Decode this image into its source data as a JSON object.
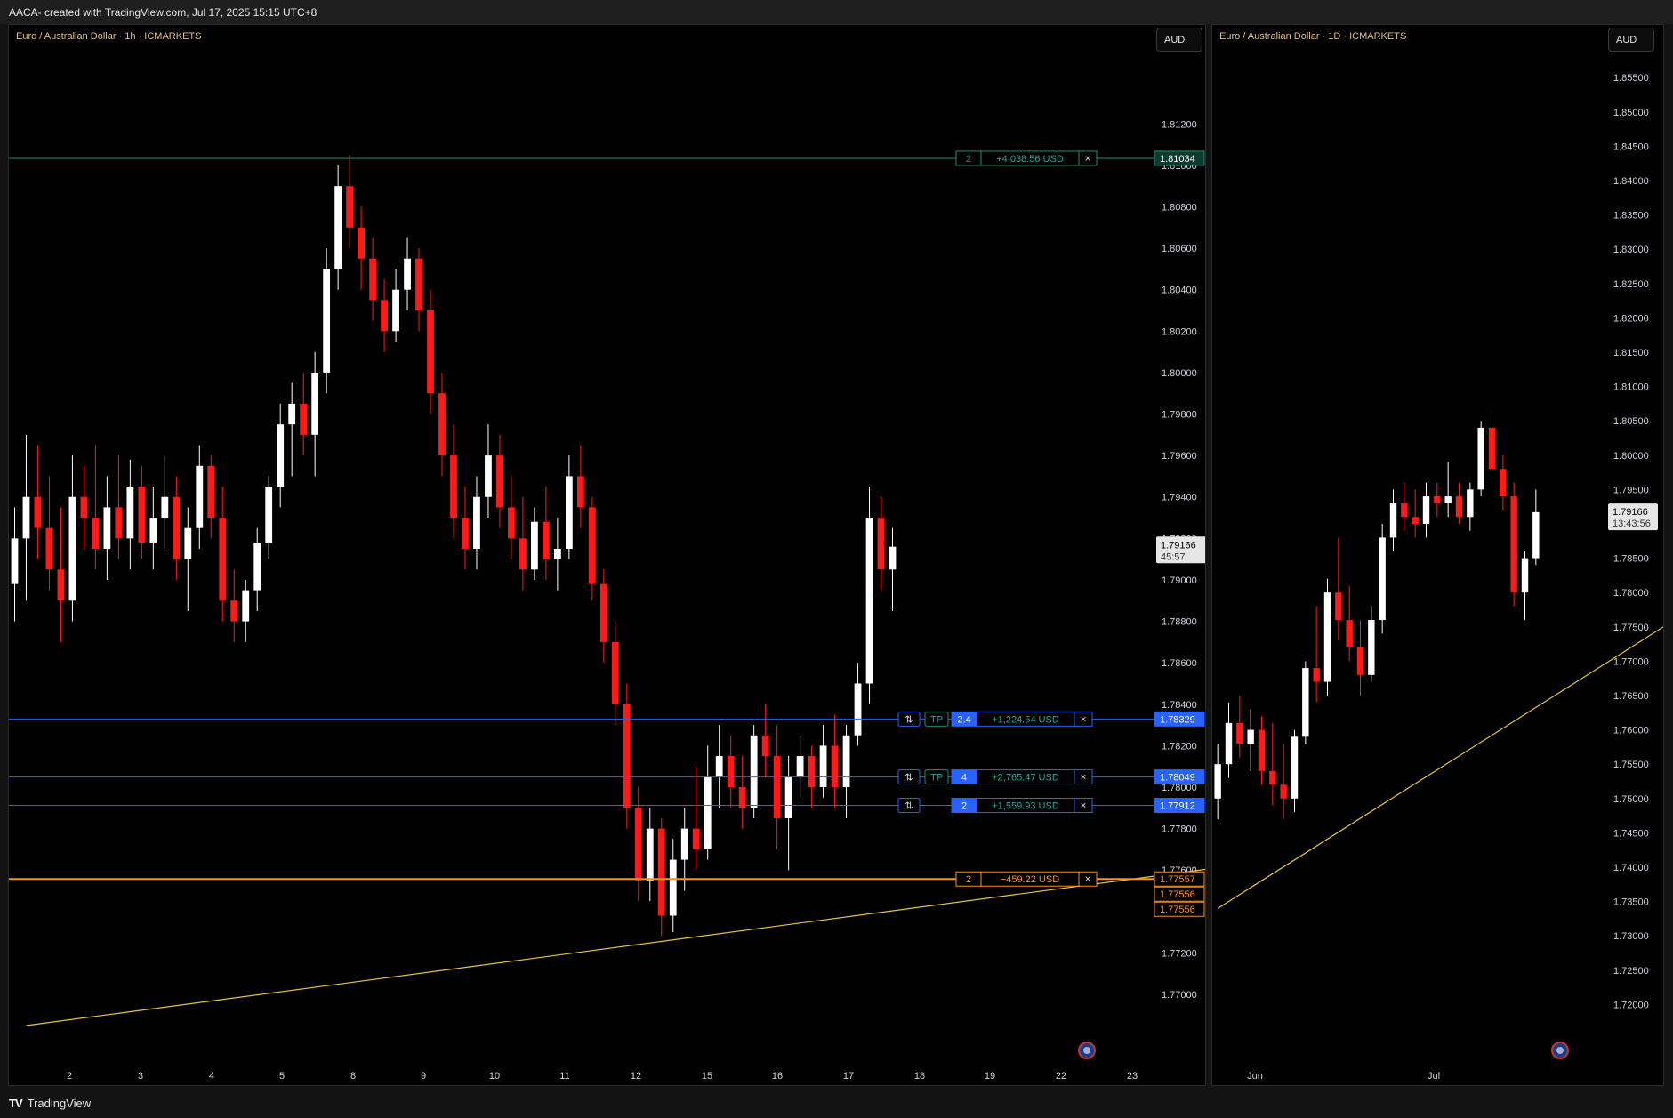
{
  "header": {
    "title": "AACA- created with TradingView.com, Jul 17, 2025 15:15 UTC+8"
  },
  "footer": {
    "logo_text": "TV",
    "brand": "TradingView"
  },
  "colors": {
    "background": "#000000",
    "up": "#ffffff",
    "down": "#ff1a1a",
    "trendline": "#e8c547",
    "tp_line": "#2962ff",
    "sl_line": "#f7931a",
    "profit_text": "#26a69a"
  },
  "left_chart": {
    "legend": "Euro / Australian Dollar · 1h · ICMARKETS",
    "currency_button": "AUD",
    "price_axis": [
      "1.81200",
      "1.81000",
      "1.80800",
      "1.80600",
      "1.80400",
      "1.80200",
      "1.80000",
      "1.79800",
      "1.79600",
      "1.79400",
      "1.79200",
      "1.79000",
      "1.78800",
      "1.78600",
      "1.78400",
      "1.78200",
      "1.78000",
      "1.77800",
      "1.77600",
      "1.77400",
      "1.77200",
      "1.77000"
    ],
    "time_axis": [
      "2",
      "3",
      "4",
      "5",
      "8",
      "9",
      "10",
      "11",
      "12",
      "15",
      "16",
      "17",
      "18",
      "19",
      "22",
      "23"
    ],
    "last_price": "1.79166",
    "countdown": "45:57",
    "orders": [
      {
        "qty": "2",
        "pnl": "+4,038.56 USD",
        "price": "1.81034",
        "tp": "",
        "close_icon": "×",
        "type": "profit"
      },
      {
        "qty": "2.4",
        "pnl": "+1,224.54 USD",
        "price": "1.78329",
        "tp": "TP",
        "reverse_icon": "⇅",
        "close_icon": "×",
        "type": "tp"
      },
      {
        "qty": "4",
        "pnl": "+2,765.47 USD",
        "price": "1.78049",
        "tp": "TP",
        "reverse_icon": "⇅",
        "close_icon": "×",
        "type": "tp"
      },
      {
        "qty": "2",
        "pnl": "+1,559.93 USD",
        "price": "1.77912",
        "tp": "",
        "reverse_icon": "⇅",
        "close_icon": "×",
        "type": "tp"
      },
      {
        "qty": "2",
        "pnl": "−459.22 USD",
        "price": "1.77557",
        "tp": "",
        "close_icon": "×",
        "type": "sl"
      }
    ],
    "extra_price_labels": [
      "1.77556",
      "1.77556"
    ]
  },
  "right_chart": {
    "legend": "Euro / Australian Dollar · 1D · ICMARKETS",
    "currency_button": "AUD",
    "price_axis": [
      "1.85500",
      "1.85000",
      "1.84500",
      "1.84000",
      "1.83500",
      "1.83000",
      "1.82500",
      "1.82000",
      "1.81500",
      "1.81000",
      "1.80500",
      "1.80000",
      "1.79500",
      "1.79000",
      "1.78500",
      "1.78000",
      "1.77500",
      "1.77000",
      "1.76500",
      "1.76000",
      "1.75500",
      "1.75000",
      "1.74500",
      "1.74000",
      "1.73500",
      "1.73000",
      "1.72500",
      "1.72000"
    ],
    "time_axis": [
      "Jun",
      "Jul"
    ],
    "last_price": "1.79166",
    "countdown": "13:43:56"
  },
  "chart_data": [
    {
      "type": "candlestick",
      "title": "Euro / Australian Dollar · 1h · ICMARKETS",
      "ylim": [
        1.7685,
        1.8142
      ],
      "x_ticks": [
        "2",
        "3",
        "4",
        "5",
        "8",
        "9",
        "10",
        "11",
        "12",
        "15",
        "16",
        "17",
        "18",
        "19",
        "22",
        "23"
      ],
      "trendline": {
        "from": [
          1,
          1.7685
        ],
        "to": [
          188,
          1.7823
        ]
      },
      "series": [
        {
          "o": 1.7898,
          "h": 1.7935,
          "l": 1.788,
          "c": 1.792
        },
        {
          "o": 1.792,
          "h": 1.797,
          "l": 1.789,
          "c": 1.794
        },
        {
          "o": 1.794,
          "h": 1.7965,
          "l": 1.791,
          "c": 1.7925
        },
        {
          "o": 1.7925,
          "h": 1.795,
          "l": 1.7895,
          "c": 1.7905
        },
        {
          "o": 1.7905,
          "h": 1.7935,
          "l": 1.787,
          "c": 1.789
        },
        {
          "o": 1.789,
          "h": 1.796,
          "l": 1.788,
          "c": 1.794
        },
        {
          "o": 1.794,
          "h": 1.7955,
          "l": 1.7915,
          "c": 1.793
        },
        {
          "o": 1.793,
          "h": 1.7965,
          "l": 1.7905,
          "c": 1.7915
        },
        {
          "o": 1.7915,
          "h": 1.795,
          "l": 1.79,
          "c": 1.7935
        },
        {
          "o": 1.7935,
          "h": 1.796,
          "l": 1.791,
          "c": 1.792
        },
        {
          "o": 1.792,
          "h": 1.7958,
          "l": 1.7905,
          "c": 1.7945
        },
        {
          "o": 1.7945,
          "h": 1.7955,
          "l": 1.791,
          "c": 1.7918
        },
        {
          "o": 1.7918,
          "h": 1.7945,
          "l": 1.7905,
          "c": 1.793
        },
        {
          "o": 1.793,
          "h": 1.796,
          "l": 1.7915,
          "c": 1.794
        },
        {
          "o": 1.794,
          "h": 1.795,
          "l": 1.79,
          "c": 1.791
        },
        {
          "o": 1.791,
          "h": 1.7935,
          "l": 1.7885,
          "c": 1.7925
        },
        {
          "o": 1.7925,
          "h": 1.7965,
          "l": 1.7915,
          "c": 1.7955
        },
        {
          "o": 1.7955,
          "h": 1.796,
          "l": 1.792,
          "c": 1.793
        },
        {
          "o": 1.793,
          "h": 1.7945,
          "l": 1.788,
          "c": 1.789
        },
        {
          "o": 1.789,
          "h": 1.7905,
          "l": 1.787,
          "c": 1.788
        },
        {
          "o": 1.788,
          "h": 1.79,
          "l": 1.787,
          "c": 1.7895
        },
        {
          "o": 1.7895,
          "h": 1.7925,
          "l": 1.7885,
          "c": 1.7918
        },
        {
          "o": 1.7918,
          "h": 1.795,
          "l": 1.791,
          "c": 1.7945
        },
        {
          "o": 1.7945,
          "h": 1.7985,
          "l": 1.7935,
          "c": 1.7975
        },
        {
          "o": 1.7975,
          "h": 1.7995,
          "l": 1.795,
          "c": 1.7985
        },
        {
          "o": 1.7985,
          "h": 1.8,
          "l": 1.796,
          "c": 1.797
        },
        {
          "o": 1.797,
          "h": 1.801,
          "l": 1.795,
          "c": 1.8
        },
        {
          "o": 1.8,
          "h": 1.806,
          "l": 1.799,
          "c": 1.805
        },
        {
          "o": 1.805,
          "h": 1.81,
          "l": 1.804,
          "c": 1.809
        },
        {
          "o": 1.809,
          "h": 1.8105,
          "l": 1.806,
          "c": 1.807
        },
        {
          "o": 1.807,
          "h": 1.808,
          "l": 1.804,
          "c": 1.8055
        },
        {
          "o": 1.8055,
          "h": 1.8065,
          "l": 1.8025,
          "c": 1.8035
        },
        {
          "o": 1.8035,
          "h": 1.8045,
          "l": 1.801,
          "c": 1.802
        },
        {
          "o": 1.802,
          "h": 1.805,
          "l": 1.8015,
          "c": 1.804
        },
        {
          "o": 1.804,
          "h": 1.8065,
          "l": 1.803,
          "c": 1.8055
        },
        {
          "o": 1.8055,
          "h": 1.806,
          "l": 1.802,
          "c": 1.803
        },
        {
          "o": 1.803,
          "h": 1.804,
          "l": 1.798,
          "c": 1.799
        },
        {
          "o": 1.799,
          "h": 1.8,
          "l": 1.795,
          "c": 1.796
        },
        {
          "o": 1.796,
          "h": 1.7975,
          "l": 1.792,
          "c": 1.793
        },
        {
          "o": 1.793,
          "h": 1.7945,
          "l": 1.7905,
          "c": 1.7915
        },
        {
          "o": 1.7915,
          "h": 1.795,
          "l": 1.7905,
          "c": 1.794
        },
        {
          "o": 1.794,
          "h": 1.7975,
          "l": 1.793,
          "c": 1.796
        },
        {
          "o": 1.796,
          "h": 1.797,
          "l": 1.7925,
          "c": 1.7935
        },
        {
          "o": 1.7935,
          "h": 1.795,
          "l": 1.791,
          "c": 1.792
        },
        {
          "o": 1.792,
          "h": 1.794,
          "l": 1.7895,
          "c": 1.7905
        },
        {
          "o": 1.7905,
          "h": 1.7935,
          "l": 1.79,
          "c": 1.7928
        },
        {
          "o": 1.7928,
          "h": 1.7945,
          "l": 1.79,
          "c": 1.791
        },
        {
          "o": 1.791,
          "h": 1.793,
          "l": 1.7895,
          "c": 1.7915
        },
        {
          "o": 1.7915,
          "h": 1.796,
          "l": 1.791,
          "c": 1.795
        },
        {
          "o": 1.795,
          "h": 1.7965,
          "l": 1.7925,
          "c": 1.7935
        },
        {
          "o": 1.7935,
          "h": 1.794,
          "l": 1.789,
          "c": 1.7898
        },
        {
          "o": 1.7898,
          "h": 1.7905,
          "l": 1.786,
          "c": 1.787
        },
        {
          "o": 1.787,
          "h": 1.788,
          "l": 1.783,
          "c": 1.784
        },
        {
          "o": 1.784,
          "h": 1.785,
          "l": 1.778,
          "c": 1.779
        },
        {
          "o": 1.779,
          "h": 1.78,
          "l": 1.7745,
          "c": 1.7755
        },
        {
          "o": 1.7755,
          "h": 1.779,
          "l": 1.7745,
          "c": 1.778
        },
        {
          "o": 1.778,
          "h": 1.7785,
          "l": 1.7728,
          "c": 1.7738
        },
        {
          "o": 1.7738,
          "h": 1.7775,
          "l": 1.773,
          "c": 1.7765
        },
        {
          "o": 1.7765,
          "h": 1.779,
          "l": 1.775,
          "c": 1.778
        },
        {
          "o": 1.778,
          "h": 1.781,
          "l": 1.776,
          "c": 1.777
        },
        {
          "o": 1.777,
          "h": 1.782,
          "l": 1.7765,
          "c": 1.7805
        },
        {
          "o": 1.7805,
          "h": 1.783,
          "l": 1.779,
          "c": 1.7815
        },
        {
          "o": 1.7815,
          "h": 1.7825,
          "l": 1.779,
          "c": 1.78
        },
        {
          "o": 1.78,
          "h": 1.7815,
          "l": 1.778,
          "c": 1.779
        },
        {
          "o": 1.779,
          "h": 1.783,
          "l": 1.7785,
          "c": 1.7825
        },
        {
          "o": 1.7825,
          "h": 1.784,
          "l": 1.7805,
          "c": 1.7815
        },
        {
          "o": 1.7815,
          "h": 1.783,
          "l": 1.777,
          "c": 1.7785
        },
        {
          "o": 1.7785,
          "h": 1.7815,
          "l": 1.776,
          "c": 1.7805
        },
        {
          "o": 1.7805,
          "h": 1.7825,
          "l": 1.7795,
          "c": 1.7815
        },
        {
          "o": 1.7815,
          "h": 1.782,
          "l": 1.779,
          "c": 1.78
        },
        {
          "o": 1.78,
          "h": 1.783,
          "l": 1.7795,
          "c": 1.782
        },
        {
          "o": 1.782,
          "h": 1.7835,
          "l": 1.779,
          "c": 1.78
        },
        {
          "o": 1.78,
          "h": 1.783,
          "l": 1.7785,
          "c": 1.7825
        },
        {
          "o": 1.7825,
          "h": 1.786,
          "l": 1.782,
          "c": 1.785
        },
        {
          "o": 1.785,
          "h": 1.7945,
          "l": 1.784,
          "c": 1.793
        },
        {
          "o": 1.793,
          "h": 1.794,
          "l": 1.7895,
          "c": 1.7905
        },
        {
          "o": 1.7905,
          "h": 1.7925,
          "l": 1.7885,
          "c": 1.7916
        }
      ]
    },
    {
      "type": "candlestick",
      "title": "Euro / Australian Dollar · 1D · ICMARKETS",
      "ylim": [
        1.715,
        1.858
      ],
      "x_ticks": [
        "Jun",
        "Jul"
      ],
      "trendline": {
        "from": [
          0,
          1.734
        ],
        "to": [
          55,
          1.7895
        ]
      },
      "series": [
        {
          "o": 1.75,
          "h": 1.758,
          "l": 1.747,
          "c": 1.755
        },
        {
          "o": 1.755,
          "h": 1.764,
          "l": 1.753,
          "c": 1.761
        },
        {
          "o": 1.761,
          "h": 1.765,
          "l": 1.756,
          "c": 1.758
        },
        {
          "o": 1.758,
          "h": 1.763,
          "l": 1.754,
          "c": 1.76
        },
        {
          "o": 1.76,
          "h": 1.762,
          "l": 1.752,
          "c": 1.754
        },
        {
          "o": 1.754,
          "h": 1.761,
          "l": 1.749,
          "c": 1.752
        },
        {
          "o": 1.752,
          "h": 1.758,
          "l": 1.747,
          "c": 1.75
        },
        {
          "o": 1.75,
          "h": 1.76,
          "l": 1.748,
          "c": 1.759
        },
        {
          "o": 1.759,
          "h": 1.77,
          "l": 1.758,
          "c": 1.769
        },
        {
          "o": 1.769,
          "h": 1.778,
          "l": 1.764,
          "c": 1.767
        },
        {
          "o": 1.767,
          "h": 1.782,
          "l": 1.765,
          "c": 1.78
        },
        {
          "o": 1.78,
          "h": 1.788,
          "l": 1.773,
          "c": 1.776
        },
        {
          "o": 1.776,
          "h": 1.781,
          "l": 1.77,
          "c": 1.772
        },
        {
          "o": 1.772,
          "h": 1.776,
          "l": 1.765,
          "c": 1.768
        },
        {
          "o": 1.768,
          "h": 1.778,
          "l": 1.767,
          "c": 1.776
        },
        {
          "o": 1.776,
          "h": 1.79,
          "l": 1.774,
          "c": 1.788
        },
        {
          "o": 1.788,
          "h": 1.795,
          "l": 1.786,
          "c": 1.793
        },
        {
          "o": 1.793,
          "h": 1.796,
          "l": 1.789,
          "c": 1.791
        },
        {
          "o": 1.791,
          "h": 1.795,
          "l": 1.788,
          "c": 1.79
        },
        {
          "o": 1.79,
          "h": 1.796,
          "l": 1.788,
          "c": 1.794
        },
        {
          "o": 1.794,
          "h": 1.796,
          "l": 1.791,
          "c": 1.793
        },
        {
          "o": 1.793,
          "h": 1.799,
          "l": 1.791,
          "c": 1.794
        },
        {
          "o": 1.794,
          "h": 1.796,
          "l": 1.79,
          "c": 1.791
        },
        {
          "o": 1.791,
          "h": 1.796,
          "l": 1.789,
          "c": 1.795
        },
        {
          "o": 1.795,
          "h": 1.805,
          "l": 1.794,
          "c": 1.804
        },
        {
          "o": 1.804,
          "h": 1.807,
          "l": 1.796,
          "c": 1.798
        },
        {
          "o": 1.798,
          "h": 1.8,
          "l": 1.792,
          "c": 1.794
        },
        {
          "o": 1.794,
          "h": 1.796,
          "l": 1.778,
          "c": 1.78
        },
        {
          "o": 1.78,
          "h": 1.786,
          "l": 1.776,
          "c": 1.785
        },
        {
          "o": 1.785,
          "h": 1.795,
          "l": 1.784,
          "c": 1.7917
        }
      ]
    }
  ]
}
